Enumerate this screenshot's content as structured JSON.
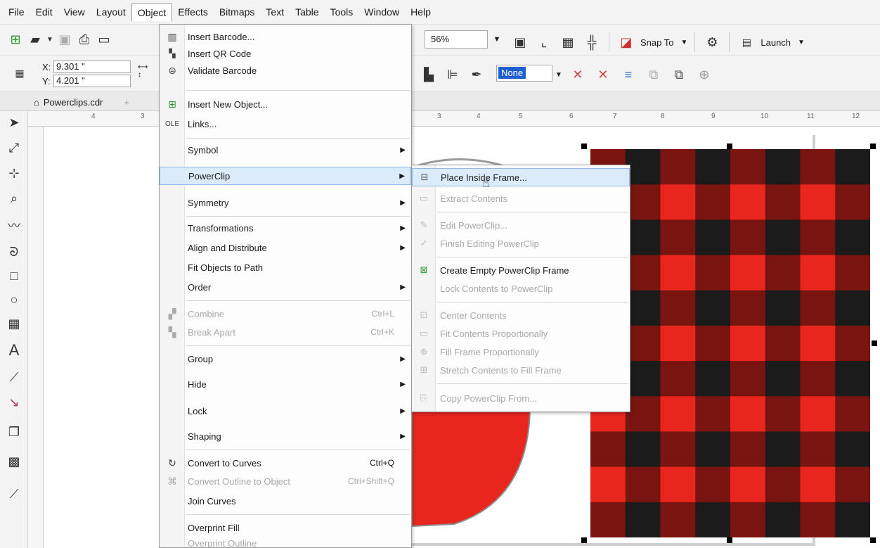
{
  "menubar": {
    "items": [
      "File",
      "Edit",
      "View",
      "Layout",
      "Object",
      "Effects",
      "Bitmaps",
      "Text",
      "Table",
      "Tools",
      "Window",
      "Help"
    ],
    "active": "Object"
  },
  "toolbar": {
    "zoom": "56%",
    "snap_to": "Snap To",
    "launch": "Launch"
  },
  "property_bar": {
    "x_label": "X:",
    "x_value": "9.301 \"",
    "y_label": "Y:",
    "y_value": "4.201 \"",
    "outline": "None"
  },
  "document_tab": {
    "name": "Powerclips.cdr"
  },
  "ruler": {
    "h_ticks": [
      "4",
      "3",
      "3",
      "4",
      "5",
      "6",
      "7",
      "8",
      "9",
      "10",
      "11",
      "12"
    ]
  },
  "object_menu": {
    "items": [
      {
        "label": "Insert Barcode...",
        "icon": "barcode-icon"
      },
      {
        "label": "Insert QR Code",
        "icon": "qr-code-icon"
      },
      {
        "label": "Validate Barcode",
        "icon": "validate-barcode-icon"
      },
      {
        "label": "Insert New Object...",
        "icon": "insert-object-icon"
      },
      {
        "label": "Links...",
        "icon": "ole-links-icon"
      },
      {
        "label": "Symbol"
      },
      {
        "label": "PowerClip"
      },
      {
        "label": "Symmetry"
      },
      {
        "label": "Transformations"
      },
      {
        "label": "Align and Distribute"
      },
      {
        "label": "Fit Objects to Path"
      },
      {
        "label": "Order"
      },
      {
        "label": "Combine",
        "shortcut": "Ctrl+L",
        "icon": "combine-icon"
      },
      {
        "label": "Break Apart",
        "shortcut": "Ctrl+K",
        "icon": "break-apart-icon"
      },
      {
        "label": "Group"
      },
      {
        "label": "Hide"
      },
      {
        "label": "Lock"
      },
      {
        "label": "Shaping"
      },
      {
        "label": "Convert to Curves",
        "shortcut": "Ctrl+Q",
        "icon": "convert-curves-icon"
      },
      {
        "label": "Convert Outline to Object",
        "shortcut": "Ctrl+Shift+Q",
        "icon": "convert-outline-icon"
      },
      {
        "label": "Join Curves"
      },
      {
        "label": "Overprint Fill"
      },
      {
        "label": "Overprint Outline"
      }
    ]
  },
  "powerclip_submenu": {
    "items": [
      {
        "label": "Place Inside Frame..."
      },
      {
        "label": "Extract Contents"
      },
      {
        "label": "Edit PowerClip..."
      },
      {
        "label": "Finish Editing PowerClip"
      },
      {
        "label": "Create Empty PowerClip Frame"
      },
      {
        "label": "Lock Contents to PowerClip"
      },
      {
        "label": "Center Contents"
      },
      {
        "label": "Fit Contents Proportionally"
      },
      {
        "label": "Fill Frame Proportionally"
      },
      {
        "label": "Stretch Contents to Fill Frame"
      },
      {
        "label": "Copy PowerClip From..."
      }
    ]
  },
  "colors": {
    "plaid_red": "#e8261e",
    "plaid_dark_red": "#7a1410",
    "plaid_black": "#1b1b1b",
    "highlight": "#dcebfa",
    "selection_blue": "#1e5fcf"
  }
}
